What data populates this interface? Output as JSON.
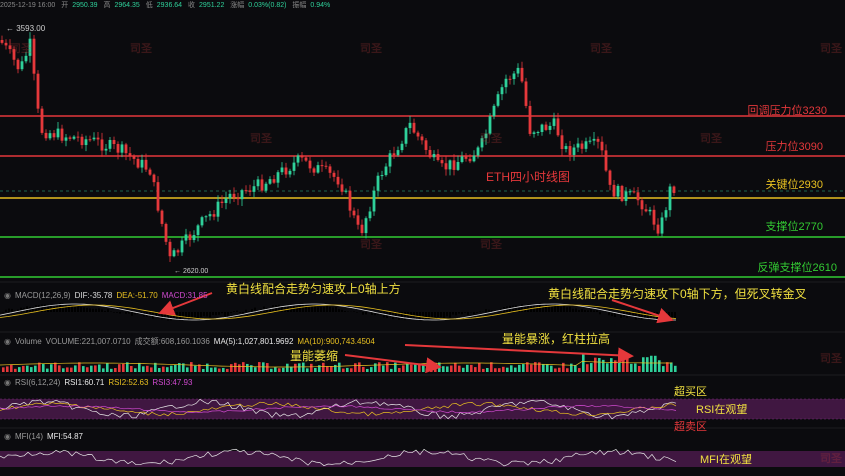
{
  "header": {
    "date": "2025-12-19 16:00",
    "open_label": "开",
    "open": "2950.39",
    "high_label": "高",
    "high": "2964.35",
    "low_label": "低",
    "low": "2936.64",
    "close_label": "收",
    "close": "2951.22",
    "change_label": "涨幅",
    "change": "0.03%(0.82)",
    "amp_label": "振幅",
    "amp": "0.94%"
  },
  "price_high_label": "← 3593.00",
  "price_low_label": "← 2620.00",
  "chart_title": "ETH四小时线图",
  "levels": [
    {
      "label": "回调压力位3230",
      "color": "#e5383b"
    },
    {
      "label": "压力位3090",
      "color": "#e5383b"
    },
    {
      "label": "关键位2930",
      "color": "#e8c020"
    },
    {
      "label": "支撑位2770",
      "color": "#33cc33"
    },
    {
      "label": "反弹支撑位2610",
      "color": "#33cc33"
    }
  ],
  "macd": {
    "name": "MACD(12,26,9)",
    "dif": "DIF:-35.78",
    "dea": "DEA:-51.70",
    "macd": "MACD:31.85",
    "note_left": "黄白线配合走势匀速攻上0轴上方",
    "note_right": "黄白线配合走势匀速攻下0轴下方，但死叉转金叉"
  },
  "volume": {
    "name": "Volume",
    "vol": "VOLUME:221,007.0710",
    "turnover": "成交额:608,160.1036",
    "ma5": "MA(5):1,027,801.9692",
    "ma10": "MA(10):900,743.4504",
    "note_left": "量能萎缩",
    "note_right": "量能暴涨，红柱拉高"
  },
  "rsi": {
    "name": "RSI(6,12,24)",
    "rsi1": "RSI1:60.71",
    "rsi2": "RSI2:52.63",
    "rsi3": "RSI3:47.93",
    "overbought": "超买区",
    "watch": "RSI在观望",
    "oversold": "超卖区"
  },
  "mfi": {
    "name": "MFI(14)",
    "mfi": "MFI:54.87",
    "watch": "MFI在观望"
  },
  "watermark": "司圣",
  "colors": {
    "up": "#2fd09a",
    "down": "#e5383b",
    "yellow": "#e8c020",
    "green": "#33cc33",
    "red": "#e5383b",
    "band": "#4a1a4a"
  }
}
